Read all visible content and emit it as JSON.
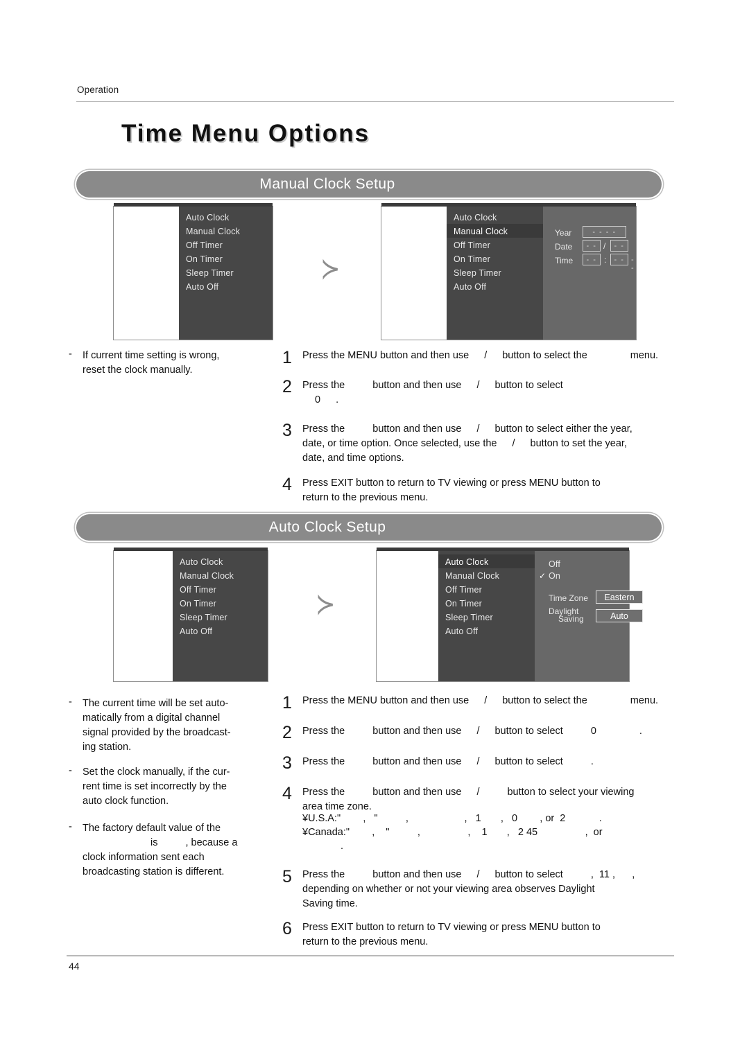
{
  "document": {
    "running_head": "Operation",
    "chapter_title": "Time Menu Options",
    "page_number": "44"
  },
  "sections": {
    "manual": {
      "heading": "Manual Clock Setup"
    },
    "auto": {
      "heading": "Auto Clock Setup"
    }
  },
  "osd_menu": {
    "items": [
      "Auto Clock",
      "Manual Clock",
      "Off Timer",
      "On Timer",
      "Sleep Timer",
      "Auto Off"
    ],
    "arrow_glyph": "≻"
  },
  "manual_clock_panel": {
    "selected_item": "Manual Clock",
    "fields": [
      {
        "label": "Year",
        "values": [
          "- - - -"
        ],
        "separator": ""
      },
      {
        "label": "Date",
        "values": [
          "- -",
          "- -"
        ],
        "separator": "/"
      },
      {
        "label": "Time",
        "values": [
          "- -",
          "- -"
        ],
        "separator": ":",
        "trailing": "- -"
      }
    ]
  },
  "auto_clock_panel": {
    "selected_item": "Auto Clock",
    "options": [
      {
        "label": "Off",
        "checked": false
      },
      {
        "label": "On",
        "checked": true
      }
    ],
    "check_glyph": "✓",
    "settings": [
      {
        "label": "Time Zone",
        "value": "Eastern"
      },
      {
        "label": "Daylight Saving",
        "label_line1": "Daylight",
        "label_line2": "Saving",
        "value": "Auto"
      }
    ]
  },
  "manual_section": {
    "notes": [
      "If current time setting is wrong, reset the clock manually."
    ],
    "steps": [
      {
        "num": "1",
        "parts": [
          "Press the MENU button and then use",
          "button to select the",
          "menu."
        ]
      },
      {
        "num": "2",
        "parts": [
          "Press the",
          "button and then use",
          "button to select",
          "0",
          "."
        ]
      },
      {
        "num": "3",
        "parts": [
          "Press the",
          "button and then use",
          "button to select either the year, date, or time option. Once selected, use the",
          "button to set the year, date, and time options."
        ]
      },
      {
        "num": "4",
        "parts": [
          "Press EXIT button to return to TV viewing or press MENU button to return to the previous menu."
        ]
      }
    ]
  },
  "auto_section": {
    "notes": [
      "The current time will be set automatically from a digital channel signal provided by the broadcasting station.",
      "Set the clock manually, if the current time is set incorrectly by the auto clock function.",
      "The factory default value of the is , because a clock information sent each broadcasting station is different."
    ],
    "note3_lines": {
      "line1": "The factory default value of the",
      "line2_a": "is",
      "line2_b": ", because a",
      "line3": "clock information sent each",
      "line4": "broadcasting station is different."
    },
    "steps": [
      {
        "num": "1",
        "parts": [
          "Press the MENU button and then use",
          "button to select the",
          "menu."
        ]
      },
      {
        "num": "2",
        "parts": [
          "Press the",
          "button and then use",
          "button to select",
          "0",
          "."
        ]
      },
      {
        "num": "3",
        "parts": [
          "Press the",
          "button and then use",
          "button to select",
          "."
        ]
      },
      {
        "num": "4",
        "parts": [
          "Press the",
          "button and then use",
          "button to select your viewing area time zone."
        ],
        "region_lines": [
          {
            "prefix": "¥U.S.A:",
            "tokens": [
              "\"",
              ",",
              "\"",
              ",",
              ",",
              "1",
              ",",
              "0",
              ", or 2",
              "."
            ]
          },
          {
            "prefix": "¥Canada:",
            "tokens": [
              "\"",
              ",",
              "\"",
              ",",
              ",",
              "1",
              ",",
              "2 45",
              ", or"
            ]
          },
          {
            "prefix": "",
            "tokens": [
              "."
            ]
          }
        ]
      },
      {
        "num": "5",
        "parts": [
          "Press the",
          "button and then use",
          "button to select",
          ", 11 ,",
          ",",
          "depending on whether or not your viewing area observes Daylight Saving time."
        ]
      },
      {
        "num": "6",
        "parts": [
          "Press EXIT button to return to TV viewing or press MENU button to return to the previous menu."
        ]
      }
    ]
  },
  "text_fragments": {
    "press_the": "Press the",
    "button_and_then_use": "button and then use",
    "button_to_select": "button to select",
    "slash": "/",
    "menu_word": "menu.",
    "the_word": "the",
    "zero": "0",
    "period": ".",
    "press_menu_line": "Press the MENU button and then use",
    "button_to_select_the": "button to select the",
    "step3_manual_rest": "button to select either the year,",
    "step3_manual_l2a": "date, or time option. Once selected, use the",
    "step3_manual_l2b": "button to set the year,",
    "step3_manual_l3": "date, and time options.",
    "exit_l1": "Press EXIT button to return to TV viewing or press MENU button to",
    "exit_l2": "return to the previous menu.",
    "step4_auto_l1": "button to select your viewing",
    "step4_auto_l2": "area time zone.",
    "usa_prefix": "¥U.S.A:",
    "canada_prefix": "¥Canada:",
    "usa_line": "\"        ,   \"          ,                    ,   1       ,   0        , or  2            .",
    "canada_line": "\"        ,    \"          ,                 ,    1       ,   2 45                 ,  or",
    "canada_line2": ".",
    "step5_l1_tail": ",  11 ,      ,",
    "step5_l2": "depending  on  whether  or  not  your  viewing  area  observes  Daylight",
    "step5_l3": "Saving time.",
    "note1_l1": "The current time will be set auto-",
    "note1_l2": "matically  from  a  digital  channel",
    "note1_l3": "signal provided by the broadcast-",
    "note1_l4": "ing station.",
    "note2_l1": "Set the clock manually, if the cur-",
    "note2_l2": "rent time is set incorrectly by the",
    "note2_l3": "auto clock function.",
    "note3_l1": "The  factory  default  value  of  the",
    "note3_l2a": "is",
    "note3_l2b": ", because a",
    "note3_l3": "clock   information   sent   each",
    "note3_l4": "broadcasting station is different.",
    "mnote_l1": "If  current  time  setting  is  wrong,",
    "mnote_l2": "reset the clock manually.",
    "dash": "-"
  }
}
